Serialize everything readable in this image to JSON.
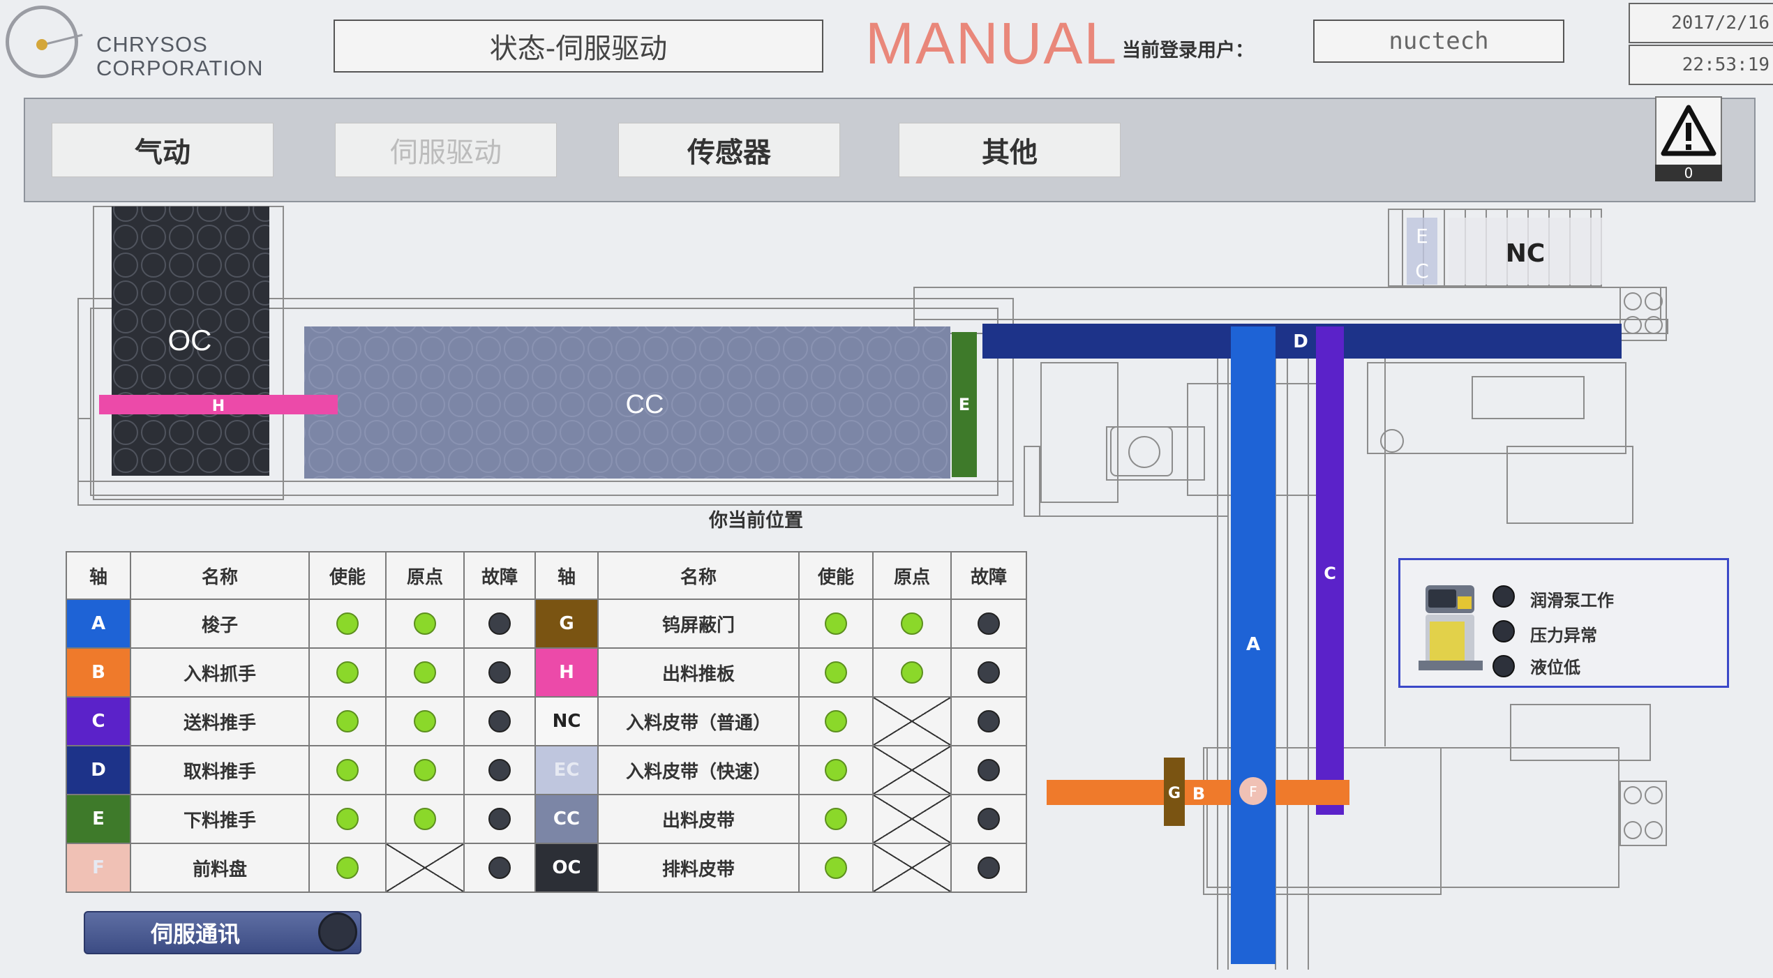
{
  "header": {
    "company_line1": "CHRYSOS",
    "company_line2": "CORPORATION",
    "screen_title": "状态-伺服驱动",
    "mode": "MANUAL",
    "login_label": "当前登录用户：",
    "user": "nuctech",
    "date": "2017/2/16",
    "time": "22:53:19"
  },
  "nav": {
    "tabs": [
      {
        "label": "气动",
        "enabled": true
      },
      {
        "label": "伺服驱动",
        "enabled": false
      },
      {
        "label": "传感器",
        "enabled": true
      },
      {
        "label": "其他",
        "enabled": true
      }
    ],
    "warning_count": "0"
  },
  "machine": {
    "position_label": "你当前位置",
    "labels": {
      "OC": "OC",
      "CC": "CC",
      "H": "H",
      "E": "E",
      "D": "D",
      "C": "C",
      "A": "A",
      "B": "B",
      "G": "G",
      "F": "F",
      "NC": "NC",
      "EC_E": "E",
      "EC_C": "C"
    }
  },
  "table": {
    "headers": [
      "轴",
      "名称",
      "使能",
      "原点",
      "故障",
      "轴",
      "名称",
      "使能",
      "原点",
      "故障"
    ],
    "rows": [
      {
        "l_code": "A",
        "l_color": "#1e63d6",
        "l_name": "梭子",
        "l_enable": "on",
        "l_origin": "on",
        "l_fault": "off",
        "r_code": "G",
        "r_color": "#7a5412",
        "r_name": "钨屏蔽门",
        "r_enable": "on",
        "r_origin": "on",
        "r_fault": "off"
      },
      {
        "l_code": "B",
        "l_color": "#ef7a2b",
        "l_name": "入料抓手",
        "l_enable": "on",
        "l_origin": "on",
        "l_fault": "off",
        "r_code": "H",
        "r_color": "#ec4aa9",
        "r_name": "出料推板",
        "r_enable": "on",
        "r_origin": "on",
        "r_fault": "off"
      },
      {
        "l_code": "C",
        "l_color": "#5b22c9",
        "l_name": "送料推手",
        "l_enable": "on",
        "l_origin": "on",
        "l_fault": "off",
        "r_code": "NC",
        "r_color": "#f7f7f7",
        "r_name": "入料皮带（普通）",
        "r_enable": "on",
        "r_origin": "x",
        "r_fault": "off"
      },
      {
        "l_code": "D",
        "l_color": "#1d3389",
        "l_name": "取料推手",
        "l_enable": "on",
        "l_origin": "on",
        "l_fault": "off",
        "r_code": "EC",
        "r_color": "#bfc6de",
        "r_name": "入料皮带（快速）",
        "r_enable": "on",
        "r_origin": "x",
        "r_fault": "off"
      },
      {
        "l_code": "E",
        "l_color": "#3e7a2a",
        "l_name": "下料推手",
        "l_enable": "on",
        "l_origin": "on",
        "l_fault": "off",
        "r_code": "CC",
        "r_color": "#7c86a6",
        "r_name": "出料皮带",
        "r_enable": "on",
        "r_origin": "x",
        "r_fault": "off"
      },
      {
        "l_code": "F",
        "l_color": "#f0c1b5",
        "l_name": "前料盘",
        "l_enable": "on",
        "l_origin": "x",
        "l_fault": "off",
        "r_code": "OC",
        "r_color": "#2c2f36",
        "r_name": "排料皮带",
        "r_enable": "on",
        "r_origin": "x",
        "r_fault": "off"
      }
    ]
  },
  "lube": {
    "items": [
      "润滑泵工作",
      "压力异常",
      "液位低"
    ]
  },
  "servo": {
    "label": "伺服通讯"
  },
  "colors": {
    "mode_text": "#e9877a",
    "lamp_on": "#8bd82a",
    "lamp_off": "#3b3f48",
    "axis_A": "#1e63d6",
    "axis_C": "#5b22c9",
    "axis_D": "#1d3389"
  }
}
